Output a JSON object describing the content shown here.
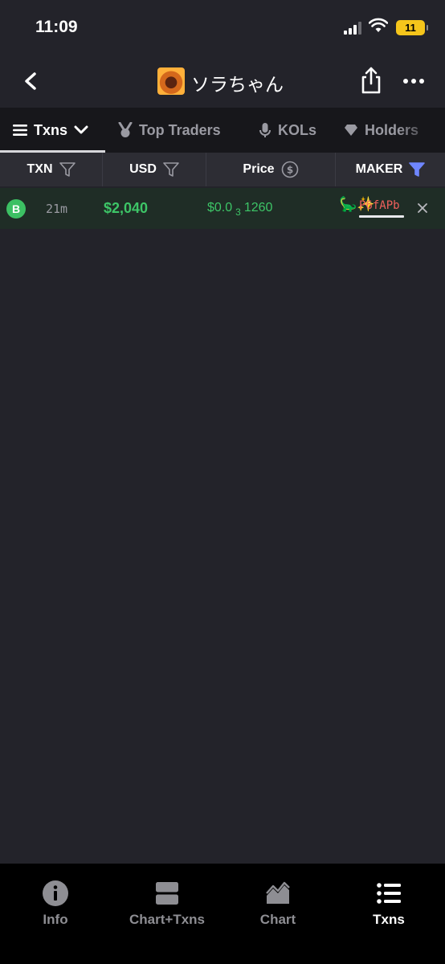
{
  "status_bar": {
    "time": "11:09",
    "battery": "11"
  },
  "header": {
    "token_name": "ソラちゃん"
  },
  "tabs": [
    {
      "label": "Txns",
      "active": true
    },
    {
      "label": "Top Traders"
    },
    {
      "label": "KOLs"
    },
    {
      "label": "Holders"
    }
  ],
  "columns": {
    "txn": "TXN",
    "usd": "USD",
    "price": "Price",
    "maker": "MAKER"
  },
  "transaction": {
    "type": "B",
    "age": "21m",
    "usd": "$2,040",
    "price_prefix": "$0.0",
    "price_zeros": "3",
    "price_digits": "1260",
    "maker_emoji": "🦕✨",
    "maker": "P6fAPb"
  },
  "bottom_nav": [
    {
      "label": "Info",
      "icon": "info-icon"
    },
    {
      "label": "Chart+Txns",
      "icon": "split-view-icon"
    },
    {
      "label": "Chart",
      "icon": "chart-icon"
    },
    {
      "label": "Txns",
      "icon": "list-icon",
      "active": true
    }
  ],
  "colors": {
    "buy": "#3dc567",
    "maker": "#f0605c",
    "filter_active": "#6f86ff"
  }
}
